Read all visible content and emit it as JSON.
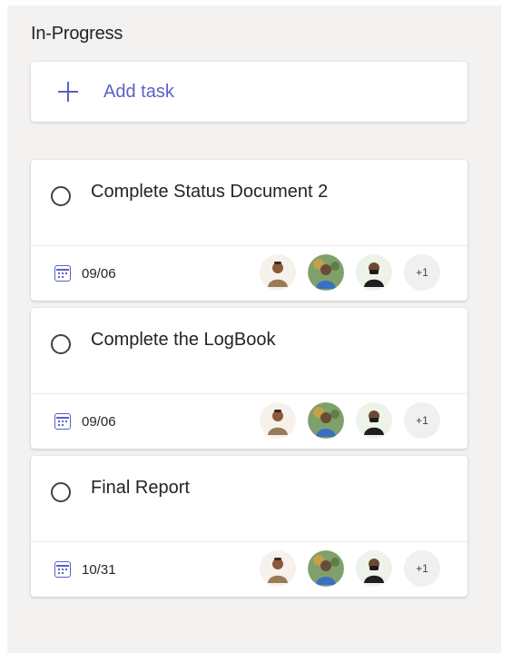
{
  "column": {
    "title": "In-Progress",
    "add_task_label": "Add task"
  },
  "colors": {
    "accent": "#5b5fc7",
    "column_bg": "#f3f2f1"
  },
  "tasks": [
    {
      "title": "Complete Status Document 2",
      "due": "09/06",
      "extra_assignees": "+1"
    },
    {
      "title": "Complete the LogBook",
      "due": "09/06",
      "extra_assignees": "+1"
    },
    {
      "title": "Final Report",
      "due": "10/31",
      "extra_assignees": "+1"
    }
  ]
}
